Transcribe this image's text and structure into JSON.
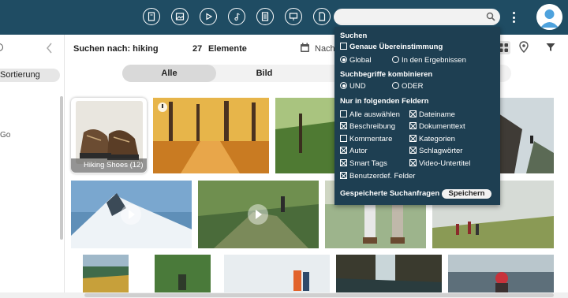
{
  "topbar": {
    "icons": [
      "document-icon",
      "image-icon",
      "video-icon",
      "music-icon",
      "text-file-icon",
      "presentation-icon",
      "file-icon"
    ],
    "search_value": "",
    "accent_color": "#1f4c63"
  },
  "sidebar": {
    "sort_label": "Sortierung",
    "partial_text": "Go"
  },
  "toolbar": {
    "search_label": "Suchen nach: hiking",
    "count": "27",
    "elements_label": "Elemente",
    "sort_label": "Nach"
  },
  "tabs": {
    "all": "Alle",
    "image": "Bild"
  },
  "album": {
    "label": "Hiking Shoes (12)"
  },
  "search_panel": {
    "title": "Suchen",
    "exact_match": "Genaue Übereinstimmung",
    "global": "Global",
    "in_results": "In den Ergebnissen",
    "combine_title": "Suchbegriffe kombinieren",
    "and": "UND",
    "or": "ODER",
    "fields_title": "Nur in folgenden Feldern",
    "fields": {
      "select_all": "Alle auswählen",
      "filename": "Dateiname",
      "description": "Beschreibung",
      "document_text": "Dokumenttext",
      "comments": "Kommentare",
      "categories": "Kategorien",
      "author": "Autor",
      "keywords": "Schlagwörter",
      "smart_tags": "Smart Tags",
      "video_subtitles": "Video-Untertitel",
      "user_fields": "Benutzerdef. Felder"
    },
    "saved_searches": "Gespeicherte Suchanfragen",
    "save_button": "Speichern",
    "panel_color": "#1e3f52"
  }
}
